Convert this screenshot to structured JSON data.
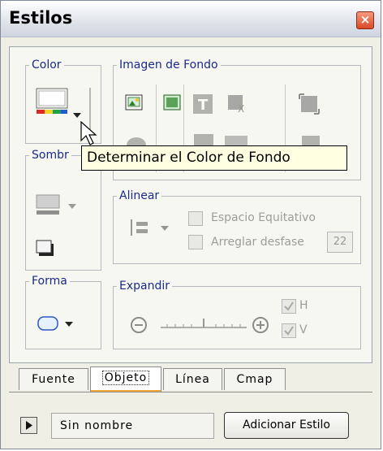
{
  "window": {
    "title": "Estilos",
    "close_glyph": "×"
  },
  "groups": {
    "color": "Color",
    "shadow": "Sombr",
    "shape": "Forma",
    "background_image": "Imagen de Fondo",
    "align": "Alinear",
    "expand": "Expandir"
  },
  "align": {
    "equal_spacing": "Espacio Equitativo",
    "fix_offset": "Arreglar desfase",
    "offset_value": "22"
  },
  "expand": {
    "h_label": "H",
    "v_label": "V",
    "h_checked": true,
    "v_checked": true
  },
  "tooltip": "Determinar el Color de Fondo",
  "tabs": [
    {
      "label": "Fuente",
      "active": false
    },
    {
      "label": "Objeto",
      "active": true
    },
    {
      "label": "Línea",
      "active": false
    },
    {
      "label": "Cmap",
      "active": false
    }
  ],
  "footer": {
    "style_name": "Sin nombre",
    "add_button": "Adicionar Estilo"
  },
  "colors": {
    "legend_text": "#1a2a88",
    "active_tab_underline": "#f1a534",
    "close_button": "#d94a26"
  },
  "icons": [
    "close-icon",
    "fill-color-icon",
    "dropdown-arrow-icon",
    "cursor-icon",
    "shadow-color-icon",
    "shadow-icon",
    "shape-rounded-rect-icon",
    "image-insert-icon",
    "image-remove-icon",
    "text-bg-icon",
    "image-fit-icon",
    "align-icon",
    "zoom-out-icon",
    "zoom-in-icon",
    "play-icon"
  ]
}
